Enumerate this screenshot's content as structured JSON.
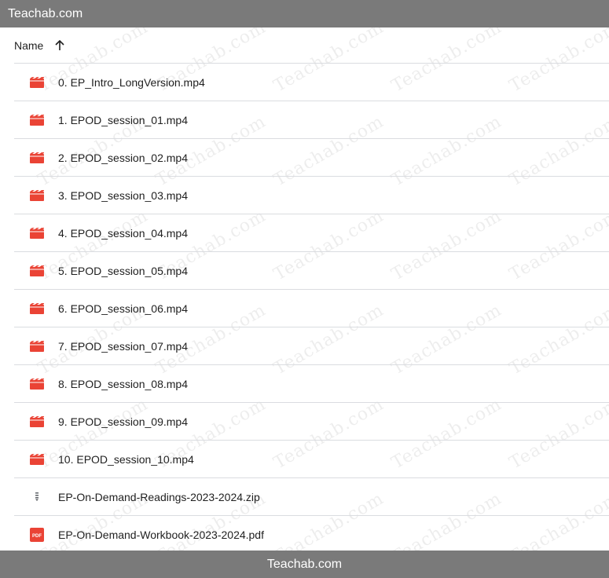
{
  "top_banner": {
    "text": "Teachab.com"
  },
  "bottom_banner": {
    "text": "Teachab.com"
  },
  "watermark_text": "Teachab.com",
  "list": {
    "column_header": "Name",
    "sort_icon": "arrow-up-icon",
    "files": [
      {
        "name": "0. EP_Intro_LongVersion.mp4",
        "type": "video"
      },
      {
        "name": "1. EPOD_session_01.mp4",
        "type": "video"
      },
      {
        "name": "2. EPOD_session_02.mp4",
        "type": "video"
      },
      {
        "name": "3. EPOD_session_03.mp4",
        "type": "video"
      },
      {
        "name": "4. EPOD_session_04.mp4",
        "type": "video"
      },
      {
        "name": "5. EPOD_session_05.mp4",
        "type": "video"
      },
      {
        "name": "6. EPOD_session_06.mp4",
        "type": "video"
      },
      {
        "name": "7. EPOD_session_07.mp4",
        "type": "video"
      },
      {
        "name": "8. EPOD_session_08.mp4",
        "type": "video"
      },
      {
        "name": "9. EPOD_session_09.mp4",
        "type": "video"
      },
      {
        "name": "10. EPOD_session_10.mp4",
        "type": "video"
      },
      {
        "name": "EP-On-Demand-Readings-2023-2024.zip",
        "type": "zip"
      },
      {
        "name": "EP-On-Demand-Workbook-2023-2024.pdf",
        "type": "pdf"
      }
    ]
  },
  "colors": {
    "video_icon": "#ea4335",
    "pdf_icon": "#ea4335",
    "zip_icon": "#5f6368",
    "banner": "#7a7a7a"
  }
}
